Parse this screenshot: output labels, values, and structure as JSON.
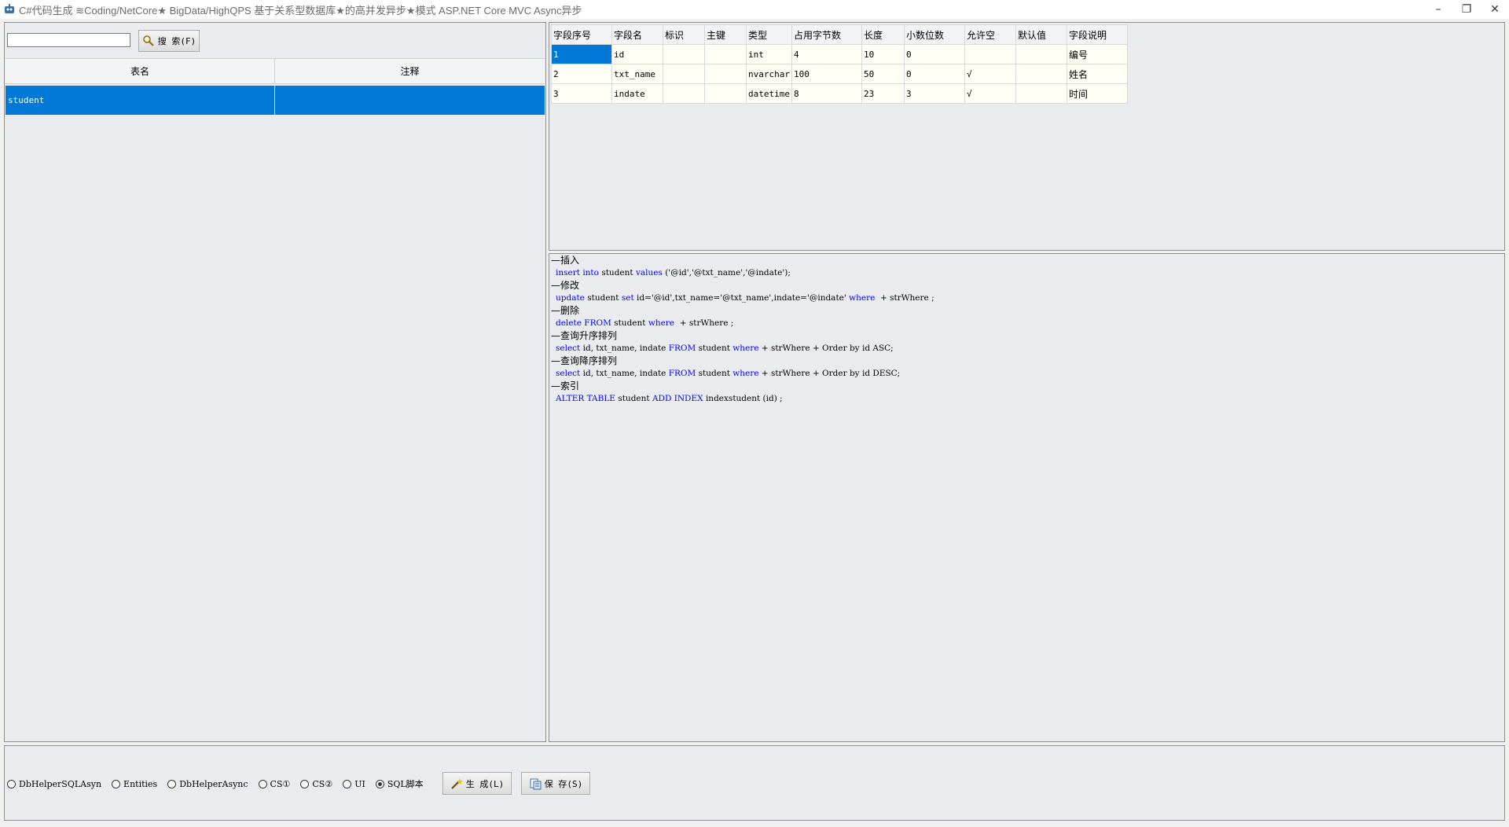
{
  "window": {
    "title": "C#代码生成 ≋Coding/NetCore★  BigData/HighQPS  基于关系型数据库★的高并发异步★模式 ASP.NET Core MVC Async异步",
    "minimize": "–",
    "restore": "❐",
    "close": "✕"
  },
  "search": {
    "value": "",
    "placeholder": "",
    "button_label": "搜 索(F)"
  },
  "table_list": {
    "headers": [
      "表名",
      "注释"
    ],
    "rows": [
      {
        "name": "student",
        "comment": ""
      }
    ]
  },
  "fields": {
    "headers": [
      "字段序号",
      "字段名",
      "标识",
      "主键",
      "类型",
      "占用字节数",
      "长度",
      "小数位数",
      "允许空",
      "默认值",
      "字段说明"
    ],
    "rows": [
      {
        "seq": "1",
        "name": "id",
        "identity": "",
        "pk": "",
        "type": "int",
        "bytes": "4",
        "length": "10",
        "scale": "0",
        "nullable": "",
        "default": "",
        "desc": "编号"
      },
      {
        "seq": "2",
        "name": "txt_name",
        "identity": "",
        "pk": "",
        "type": "nvarchar",
        "bytes": "100",
        "length": "50",
        "scale": "0",
        "nullable": "√",
        "default": "",
        "desc": "姓名"
      },
      {
        "seq": "3",
        "name": "indate",
        "identity": "",
        "pk": "",
        "type": "datetime",
        "bytes": "8",
        "length": "23",
        "scale": "3",
        "nullable": "√",
        "default": "",
        "desc": "时间"
      }
    ]
  },
  "sql": {
    "insert_comment": "—插入",
    "insert_kw1": "insert",
    "insert_kw2": "into",
    "insert_t1": " student ",
    "insert_kw3": "values",
    "insert_t2": " ('@id','@txt_name','@indate');",
    "update_comment": "—修改",
    "update_kw1": "update",
    "update_t1": " student ",
    "update_kw2": "set",
    "update_t2": " id='@id',txt_name='@txt_name',indate='@indate' ",
    "update_kw3": "where",
    "update_t3": "  + strWhere ;",
    "delete_comment": "—删除",
    "delete_kw1": "delete",
    "delete_kw2": "FROM",
    "delete_t1": " student ",
    "delete_kw3": "where",
    "delete_t2": "  + strWhere ;",
    "asc_comment": "—查询升序排列",
    "asc_kw1": "select",
    "asc_t1": " id, txt_name, indate ",
    "asc_kw2": "FROM",
    "asc_t2": " student ",
    "asc_kw3": "where",
    "asc_t3": " + strWhere + Order by id ASC;",
    "desc_comment": "—查询降序排列",
    "desc_kw1": "select",
    "desc_t1": " id, txt_name, indate ",
    "desc_kw2": "FROM",
    "desc_t2": " student ",
    "desc_kw3": "where",
    "desc_t3": " + strWhere + Order by id DESC;",
    "index_comment": "—索引",
    "index_kw1": "ALTER TABLE",
    "index_t1": " student ",
    "index_kw2": "ADD INDEX",
    "index_t2": " indexstudent (id) ;"
  },
  "options": {
    "radios": [
      "DbHelperSQLAsyn",
      "Entities",
      "DbHelperAsync",
      "CS①",
      "CS②",
      "UI",
      "SQL脚本"
    ],
    "selected": "SQL脚本",
    "generate_label": "生 成(L)",
    "save_label": "保 存(S)"
  },
  "colors": {
    "selection": "#0078d7",
    "keyword": "#0000ff",
    "panel_bg": "#e9ebee"
  }
}
